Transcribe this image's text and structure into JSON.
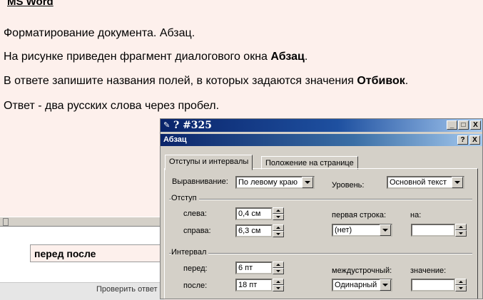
{
  "question": {
    "title": "MS Word",
    "line1": "Форматирование документа. Абзац.",
    "line2_text": "На рисунке приведен фрагмент диалогового окна ",
    "line2_bold": "Абзац",
    "line2_end": ".",
    "line3_text": "В ответе запишите названия полей, в которых задаются значения ",
    "line3_bold": "Отбивок",
    "line3_end": ".",
    "line4": "Ответ - два русских слова через пробел."
  },
  "answer": {
    "value": "перед после",
    "check_button": "Проверить ответ"
  },
  "window": {
    "title": "? #325",
    "minimize": "_",
    "maximize": "□",
    "close": "X"
  },
  "dialog": {
    "title": "Абзац",
    "help": "?",
    "close": "X",
    "tabs": [
      "Отступы и интервалы",
      "Положение на странице"
    ],
    "alignment_label": "Выравнивание:",
    "alignment_value": "По левому краю",
    "level_label": "Уровень:",
    "level_value": "Основной текст",
    "indent_group": "Отступ",
    "left_label": "слева:",
    "left_value": "0,4 см",
    "right_label": "справа:",
    "right_value": "6,3 см",
    "first_line_label": "первая строка:",
    "first_line_value": "(нет)",
    "by_label": "на:",
    "by_value": "",
    "spacing_group": "Интервал",
    "before_label": "перед:",
    "before_value": "6 пт",
    "after_label": "после:",
    "after_value": "18 пт",
    "line_spacing_label": "междустрочный:",
    "line_spacing_value": "Одинарный",
    "at_label": "значение:",
    "at_value": ""
  }
}
